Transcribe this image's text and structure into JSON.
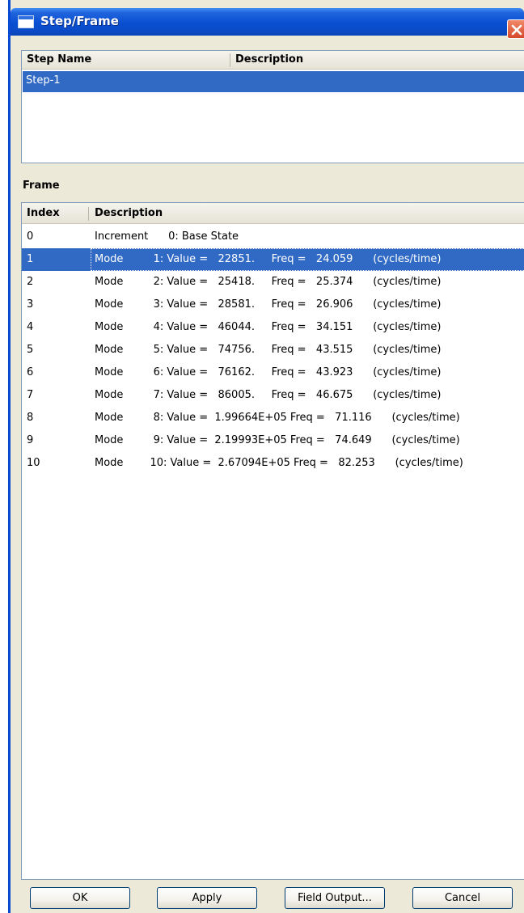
{
  "window": {
    "title": "Step/Frame"
  },
  "step_table": {
    "headers": {
      "name": "Step Name",
      "description": "Description"
    },
    "rows": [
      {
        "name": "Step-1",
        "description": ""
      }
    ]
  },
  "frame_section": {
    "label": "Frame"
  },
  "frame_table": {
    "headers": {
      "index": "Index",
      "description": "Description"
    },
    "rows": [
      {
        "index": "0",
        "description": "Increment      0: Base State"
      },
      {
        "index": "1",
        "description": "Mode         1: Value =   22851.     Freq =   24.059      (cycles/time)"
      },
      {
        "index": "2",
        "description": "Mode         2: Value =   25418.     Freq =   25.374      (cycles/time)"
      },
      {
        "index": "3",
        "description": "Mode         3: Value =   28581.     Freq =   26.906      (cycles/time)"
      },
      {
        "index": "4",
        "description": "Mode         4: Value =   46044.     Freq =   34.151      (cycles/time)"
      },
      {
        "index": "5",
        "description": "Mode         5: Value =   74756.     Freq =   43.515      (cycles/time)"
      },
      {
        "index": "6",
        "description": "Mode         6: Value =   76162.     Freq =   43.923      (cycles/time)"
      },
      {
        "index": "7",
        "description": "Mode         7: Value =   86005.     Freq =   46.675      (cycles/time)"
      },
      {
        "index": "8",
        "description": "Mode         8: Value =  1.99664E+05 Freq =   71.116      (cycles/time)"
      },
      {
        "index": "9",
        "description": "Mode         9: Value =  2.19993E+05 Freq =   74.649      (cycles/time)"
      },
      {
        "index": "10",
        "description": "Mode        10: Value =  2.67094E+05 Freq =   82.253      (cycles/time)"
      }
    ],
    "selected_index": 1
  },
  "buttons": {
    "ok": "OK",
    "apply": "Apply",
    "field_output": "Field Output...",
    "cancel": "Cancel"
  },
  "colors": {
    "selection": "#316ac5",
    "titlebar": "#0a4fd3",
    "dialog_bg": "#ece9d8"
  }
}
